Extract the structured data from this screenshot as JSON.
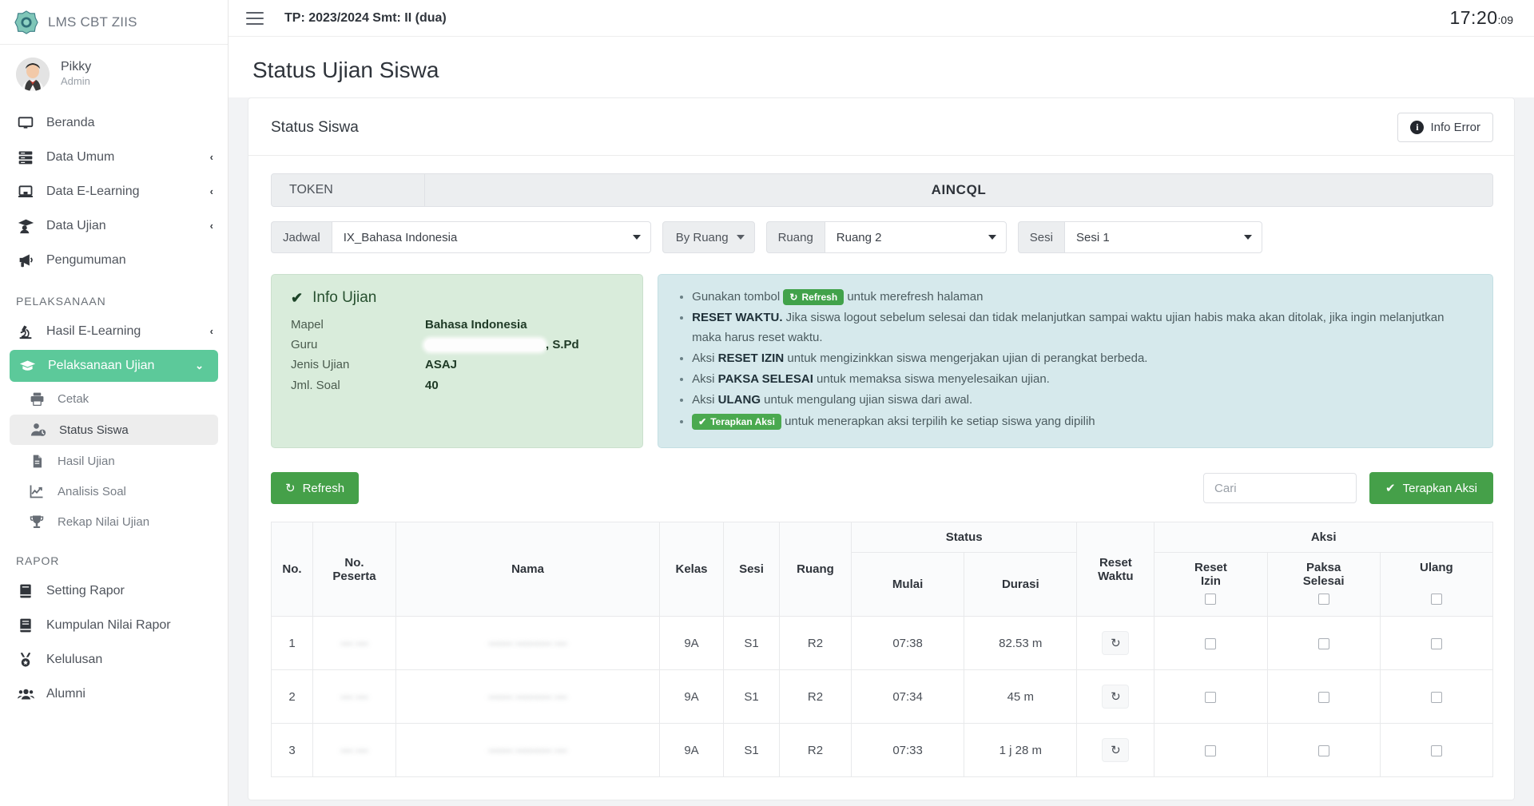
{
  "brand": {
    "title": "LMS CBT ZIIS",
    "logo_icon": "app-logo-icon"
  },
  "profile": {
    "name": "Pikky",
    "role": "Admin"
  },
  "sidebar": {
    "items": [
      {
        "label": "Beranda",
        "icon": "monitor-icon",
        "chevron": ""
      },
      {
        "label": "Data Umum",
        "icon": "server-icon",
        "chevron": "‹"
      },
      {
        "label": "Data E-Learning",
        "icon": "laptop-icon",
        "chevron": "‹"
      },
      {
        "label": "Data Ujian",
        "icon": "graduate-icon",
        "chevron": "‹"
      },
      {
        "label": "Pengumuman",
        "icon": "megaphone-icon",
        "chevron": ""
      }
    ],
    "section_pelaksanaan": "PELAKSANAAN",
    "pelaksanaan_items": [
      {
        "label": "Hasil E-Learning",
        "icon": "microscope-icon",
        "chevron": "‹"
      },
      {
        "label": "Pelaksanaan Ujian",
        "icon": "graduate-cap-icon",
        "chevron": "⌄"
      }
    ],
    "sub_items": [
      {
        "label": "Cetak",
        "icon": "printer-icon"
      },
      {
        "label": "Status Siswa",
        "icon": "user-clock-icon"
      },
      {
        "label": "Hasil Ujian",
        "icon": "document-icon"
      },
      {
        "label": "Analisis Soal",
        "icon": "chart-line-icon"
      },
      {
        "label": "Rekap Nilai Ujian",
        "icon": "trophy-icon"
      }
    ],
    "section_rapor": "RAPOR",
    "rapor_items": [
      {
        "label": "Setting Rapor",
        "icon": "book-icon"
      },
      {
        "label": "Kumpulan Nilai Rapor",
        "icon": "books-icon"
      },
      {
        "label": "Kelulusan",
        "icon": "medal-icon"
      },
      {
        "label": "Alumni",
        "icon": "users-icon"
      }
    ]
  },
  "topbar": {
    "tp_title": "TP: 2023/2024 Smt: II (dua)",
    "clock_time": "17:20",
    "clock_seconds": ":09"
  },
  "page": {
    "title": "Status Ujian Siswa"
  },
  "card": {
    "title": "Status Siswa",
    "info_error_label": "Info Error"
  },
  "token": {
    "label": "TOKEN",
    "value": "AINCQL"
  },
  "filters": {
    "jadwal_label": "Jadwal",
    "jadwal_value": "IX_Bahasa Indonesia",
    "by_label": "By Ruang",
    "ruang_label": "Ruang",
    "ruang_value": "Ruang 2",
    "sesi_label": "Sesi",
    "sesi_value": "Sesi 1"
  },
  "info_ujian": {
    "heading": "Info Ujian",
    "rows": [
      {
        "key": "Mapel",
        "value": "Bahasa Indonesia",
        "redacted": false
      },
      {
        "key": "Guru",
        "value": ", S.Pd",
        "redacted": true
      },
      {
        "key": "Jenis Ujian",
        "value": "ASAJ",
        "redacted": false
      },
      {
        "key": "Jml. Soal",
        "value": "40",
        "redacted": false
      }
    ]
  },
  "info_panel": {
    "b1_pre": "Gunakan tombol",
    "b1_btn": "Refresh",
    "b1_post": "untuk merefresh halaman",
    "b2_strong": "RESET WAKTU.",
    "b2_text": "Jika siswa logout sebelum selesai dan tidak melanjutkan sampai waktu ujian habis maka akan ditolak, jika ingin melanjutkan maka harus reset waktu.",
    "b3_pre": "Aksi",
    "b3_strong": "RESET IZIN",
    "b3_post": "untuk mengizinkkan siswa mengerjakan ujian di perangkat berbeda.",
    "b4_pre": "Aksi",
    "b4_strong": "PAKSA SELESAI",
    "b4_post": "untuk memaksa siswa menyelesaikan ujian.",
    "b5_pre": "Aksi",
    "b5_strong": "ULANG",
    "b5_post": "untuk mengulang ujian siswa dari awal.",
    "b6_btn": "Terapkan Aksi",
    "b6_post": "untuk menerapkan aksi terpilih ke setiap siswa yang dipilih"
  },
  "toolbar": {
    "refresh_label": "Refresh",
    "search_placeholder": "Cari",
    "search_value": "",
    "apply_label": "Terapkan Aksi"
  },
  "table": {
    "group_status": "Status",
    "group_aksi": "Aksi",
    "headers": {
      "no": "No.",
      "no_peserta": "No. Peserta",
      "no_peserta_l1": "No.",
      "no_peserta_l2": "Peserta",
      "nama": "Nama",
      "kelas": "Kelas",
      "sesi": "Sesi",
      "ruang": "Ruang",
      "mulai": "Mulai",
      "durasi": "Durasi",
      "reset_waktu_l1": "Reset",
      "reset_waktu_l2": "Waktu",
      "reset_izin_l1": "Reset",
      "reset_izin_l2": "Izin",
      "paksa_l1": "Paksa",
      "paksa_l2": "Selesai",
      "ulang": "Ulang"
    },
    "rows": [
      {
        "no": "1",
        "no_peserta": "— —",
        "nama": "—— ——— —",
        "kelas": "9A",
        "sesi": "S1",
        "ruang": "R2",
        "mulai": "07:38",
        "durasi": "82.53 m"
      },
      {
        "no": "2",
        "no_peserta": "— —",
        "nama": "—— ——— —",
        "kelas": "9A",
        "sesi": "S1",
        "ruang": "R2",
        "mulai": "07:34",
        "durasi": "45 m"
      },
      {
        "no": "3",
        "no_peserta": "— —",
        "nama": "—— ——— —",
        "kelas": "9A",
        "sesi": "S1",
        "ruang": "R2",
        "mulai": "07:33",
        "durasi": "1 j 28 m"
      }
    ]
  }
}
